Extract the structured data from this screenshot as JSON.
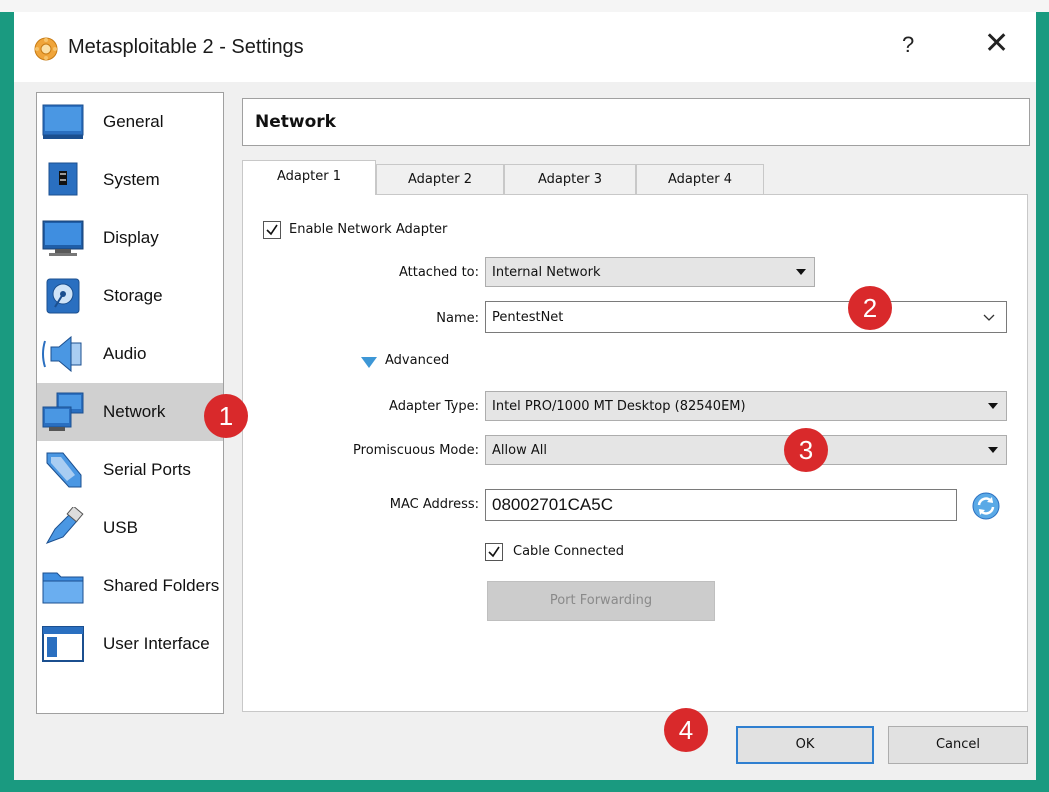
{
  "window": {
    "title": "Metasploitable 2 - Settings",
    "help_label": "?",
    "close_label": "✕"
  },
  "sidebar": {
    "items": [
      {
        "label": "General",
        "icon": "general-icon"
      },
      {
        "label": "System",
        "icon": "system-icon"
      },
      {
        "label": "Display",
        "icon": "display-icon"
      },
      {
        "label": "Storage",
        "icon": "storage-icon"
      },
      {
        "label": "Audio",
        "icon": "audio-icon"
      },
      {
        "label": "Network",
        "icon": "network-icon",
        "selected": true
      },
      {
        "label": "Serial Ports",
        "icon": "serial-ports-icon"
      },
      {
        "label": "USB",
        "icon": "usb-icon"
      },
      {
        "label": "Shared Folders",
        "icon": "shared-folders-icon"
      },
      {
        "label": "User Interface",
        "icon": "user-interface-icon"
      }
    ]
  },
  "header": {
    "title": "Network"
  },
  "tabs": [
    {
      "label": "Adapter 1",
      "active": true
    },
    {
      "label": "Adapter 2"
    },
    {
      "label": "Adapter 3"
    },
    {
      "label": "Adapter 4"
    }
  ],
  "adapter": {
    "enable_label": "Enable Network Adapter",
    "enable_checked": true,
    "attached_label": "Attached to:",
    "attached_value": "Internal Network",
    "name_label": "Name:",
    "name_value": "PentestNet",
    "advanced_label": "Advanced",
    "adapter_type_label": "Adapter Type:",
    "adapter_type_value": "Intel PRO/1000 MT Desktop (82540EM)",
    "promiscuous_label": "Promiscuous Mode:",
    "promiscuous_value": "Allow All",
    "mac_label": "MAC Address:",
    "mac_value": "08002701CA5C",
    "cable_label": "Cable Connected",
    "cable_checked": true,
    "port_forwarding_label": "Port Forwarding"
  },
  "buttons": {
    "ok_label": "OK",
    "cancel_label": "Cancel"
  },
  "annotations": [
    "1",
    "2",
    "3",
    "4"
  ],
  "colors": {
    "border_accent": "#1a9a80",
    "badge": "#d9292b",
    "selection": "#d0d0d0",
    "advanced_arrow": "#3d97d6",
    "ok_border": "#2f7fd0"
  }
}
